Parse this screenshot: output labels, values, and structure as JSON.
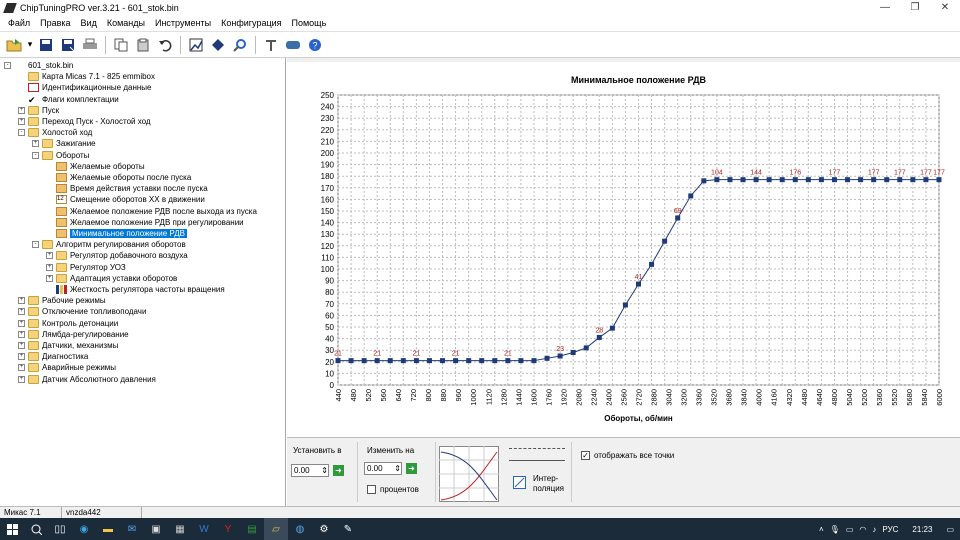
{
  "window": {
    "title": "ChipTuningPRO ver.3.21 - 601_stok.bin"
  },
  "menu": [
    "Файл",
    "Правка",
    "Вид",
    "Команды",
    "Инструменты",
    "Конфигурация",
    "Помощь"
  ],
  "tree": {
    "root": "601_stok.bin",
    "items": [
      {
        "label": "Карта Micas 7.1 - 825 emmibox",
        "level": 1,
        "icon": "folder",
        "exp": ""
      },
      {
        "label": "Идентификационные данные",
        "level": 1,
        "icon": "doc-icon",
        "exp": ""
      },
      {
        "label": "Флаги комплектации",
        "level": 1,
        "icon": "check-icon",
        "exp": ""
      },
      {
        "label": "Пуск",
        "level": 1,
        "icon": "folder",
        "exp": "+"
      },
      {
        "label": "Переход Пуск - Холостой ход",
        "level": 1,
        "icon": "folder",
        "exp": "+"
      },
      {
        "label": "Холостой ход",
        "level": 1,
        "icon": "folder",
        "exp": "-"
      },
      {
        "label": "Зажигание",
        "level": 2,
        "icon": "folder",
        "exp": "+"
      },
      {
        "label": "Обороты",
        "level": 2,
        "icon": "folder",
        "exp": "-"
      },
      {
        "label": "Желаемые обороты",
        "level": 3,
        "icon": "map",
        "exp": ""
      },
      {
        "label": "Желаемые обороты после пуска",
        "level": 3,
        "icon": "map",
        "exp": ""
      },
      {
        "label": "Время действия уставки после пуска",
        "level": 3,
        "icon": "map",
        "exp": ""
      },
      {
        "label": "Смещение оборотов ХХ в движении",
        "level": 3,
        "icon": "num",
        "exp": ""
      },
      {
        "label": "Желаемое положение РДВ после выхода из пуска",
        "level": 3,
        "icon": "map",
        "exp": ""
      },
      {
        "label": "Желаемое положение РДВ при регулировании",
        "level": 3,
        "icon": "map",
        "exp": ""
      },
      {
        "label": "Минимальное положение РДВ",
        "level": 3,
        "icon": "map",
        "exp": "",
        "selected": true
      },
      {
        "label": "Алгоритм регулирования оборотов",
        "level": 2,
        "icon": "folder",
        "exp": "-"
      },
      {
        "label": "Регулятор добавочного воздуха",
        "level": 3,
        "icon": "folder",
        "exp": "+"
      },
      {
        "label": "Регулятор УОЗ",
        "level": 3,
        "icon": "folder",
        "exp": "+"
      },
      {
        "label": "Адаптация уставки оборотов",
        "level": 3,
        "icon": "folder",
        "exp": "+"
      },
      {
        "label": "Жесткость регулятора частоты вращения",
        "level": 3,
        "icon": "bars",
        "exp": ""
      },
      {
        "label": "Рабочие режимы",
        "level": 1,
        "icon": "folder",
        "exp": "+"
      },
      {
        "label": "Отключение топливоподачи",
        "level": 1,
        "icon": "folder",
        "exp": "+"
      },
      {
        "label": "Контроль детонации",
        "level": 1,
        "icon": "folder",
        "exp": "+"
      },
      {
        "label": "Лямбда-регулирование",
        "level": 1,
        "icon": "folder",
        "exp": "+"
      },
      {
        "label": "Датчики, механизмы",
        "level": 1,
        "icon": "folder",
        "exp": "+"
      },
      {
        "label": "Диагностика",
        "level": 1,
        "icon": "folder",
        "exp": "+"
      },
      {
        "label": "Аварийные режимы",
        "level": 1,
        "icon": "folder",
        "exp": "+"
      },
      {
        "label": "Датчик Абсолютного давления",
        "level": 1,
        "icon": "folder",
        "exp": "+"
      }
    ]
  },
  "chart_data": {
    "type": "line",
    "title": "Минимальное положение РДВ",
    "xlabel": "Обороты, об/мин",
    "ylabel": "",
    "x": [
      440,
      480,
      520,
      560,
      600,
      640,
      680,
      720,
      760,
      800,
      840,
      880,
      920,
      960,
      1000,
      1040,
      1120,
      1280,
      1440,
      1600,
      1760,
      1920,
      2080,
      2240,
      2400,
      2560,
      2720,
      2880,
      3040,
      3200,
      3360,
      3520,
      3680,
      3840,
      4000,
      4160,
      4320,
      4480,
      4640,
      4800,
      5040,
      5200,
      5360,
      5520,
      5680,
      5840,
      6000
    ],
    "xticks": [
      440,
      480,
      520,
      560,
      600,
      640,
      680,
      720,
      760,
      800,
      840,
      880,
      920,
      960,
      1000,
      1040,
      1120,
      1280,
      1440,
      1600,
      1760,
      1920,
      2080,
      2240,
      2400,
      2560,
      2720,
      2880,
      3040,
      3200,
      3360,
      3520,
      3680,
      3840,
      4000,
      4160,
      4320,
      4480,
      4640,
      4800,
      5040,
      5200,
      5360,
      5520,
      5680,
      5840,
      6000
    ],
    "xtick_labels": [
      "440",
      "480",
      "520",
      "560",
      "640",
      "720",
      "800",
      "880",
      "960",
      "1000",
      "1120",
      "1280",
      "1440",
      "1600",
      "1760",
      "1920",
      "2080",
      "2240",
      "2400",
      "2560",
      "2720",
      "2880",
      "3040",
      "3200",
      "3360",
      "3520",
      "3680",
      "3840",
      "4000",
      "4160",
      "4320",
      "4480",
      "4640",
      "4800",
      "5040",
      "5200",
      "5360",
      "5520",
      "5680",
      "5840",
      "6000"
    ],
    "ylim": [
      0,
      250
    ],
    "yticks": [
      0,
      10,
      20,
      30,
      40,
      50,
      60,
      70,
      80,
      90,
      100,
      110,
      120,
      130,
      140,
      150,
      160,
      170,
      180,
      190,
      200,
      210,
      220,
      230,
      240,
      250
    ],
    "grid": true,
    "points": [
      21,
      21,
      21,
      21,
      21,
      21,
      21,
      21,
      21,
      21,
      21,
      21,
      21,
      21,
      21,
      21,
      23,
      25,
      28,
      32,
      41,
      49,
      69,
      87,
      104,
      124,
      144,
      163,
      176,
      177,
      177,
      177,
      177,
      177,
      177,
      177,
      177,
      177,
      177,
      177,
      177,
      177,
      177,
      177,
      177,
      177,
      177
    ],
    "labels": [
      {
        "i": 0,
        "text": "21"
      },
      {
        "i": 3,
        "text": "21"
      },
      {
        "i": 6,
        "text": "21"
      },
      {
        "i": 9,
        "text": "21"
      },
      {
        "i": 13,
        "text": "21"
      },
      {
        "i": 17,
        "text": "23"
      },
      {
        "i": 20,
        "text": "28"
      },
      {
        "i": 23,
        "text": "41"
      },
      {
        "i": 26,
        "text": "69"
      },
      {
        "i": 29,
        "text": "104"
      },
      {
        "i": 32,
        "text": "144"
      },
      {
        "i": 35,
        "text": "176"
      },
      {
        "i": 38,
        "text": "177"
      },
      {
        "i": 41,
        "text": "177"
      },
      {
        "i": 43,
        "text": "177"
      },
      {
        "i": 45,
        "text": "177"
      },
      {
        "i": 46,
        "text": "177"
      }
    ]
  },
  "controls": {
    "set_label": "Установить в",
    "set_value": "0.00",
    "change_label": "Изменить на",
    "change_value": "0.00",
    "percent_label": "процентов",
    "interp_label": "Интер-\nполяция",
    "show_all_label": "отображать все точки"
  },
  "status": {
    "left": "Микас 7.1",
    "mid": "vnzda442"
  },
  "taskbar": {
    "lang": "РУС",
    "time": "21:23"
  },
  "colors": {
    "selection": "#0078d7",
    "series": "#1f3a7a",
    "label": "#b02020"
  }
}
